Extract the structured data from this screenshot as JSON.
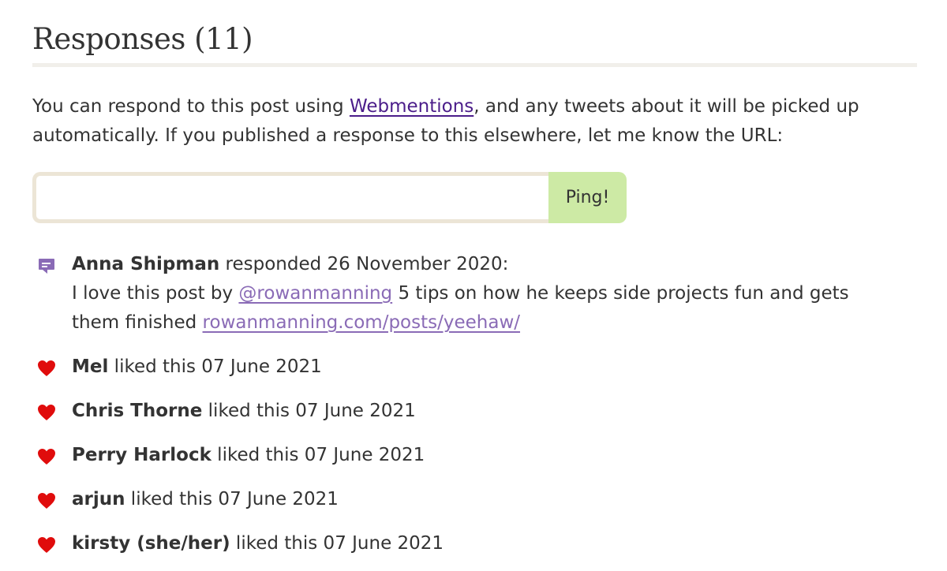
{
  "section": {
    "title": "Responses (11)"
  },
  "intro": {
    "before_link": "You can respond to this post using ",
    "link_text": "Webmentions",
    "after_link": ", and any tweets about it will be picked up automatically. If you published a response to this elsewhere, let me know the URL:"
  },
  "ping_form": {
    "input_value": "",
    "input_placeholder": "",
    "button_label": "Ping!"
  },
  "reply": {
    "icon": "comment-icon",
    "author": "Anna Shipman",
    "action": " responded 26 November 2020:",
    "text_before_mention": "I love this post by ",
    "mention": "@rowanmanning",
    "text_after_mention": " 5 tips on how he keeps side projects fun and gets them finished ",
    "url_text": "rowanmanning.com/posts/yeehaw/"
  },
  "likes": [
    {
      "icon": "heart-icon",
      "author": "Mel",
      "action": " liked this 07 June 2021"
    },
    {
      "icon": "heart-icon",
      "author": "Chris Thorne",
      "action": " liked this 07 June 2021"
    },
    {
      "icon": "heart-icon",
      "author": "Perry Harlock",
      "action": " liked this 07 June 2021"
    },
    {
      "icon": "heart-icon",
      "author": "arjun",
      "action": " liked this 07 June 2021"
    },
    {
      "icon": "heart-icon",
      "author": "kirsty (she/her)",
      "action": " liked this 07 June 2021"
    }
  ],
  "colors": {
    "text": "#333333",
    "link": "#4b1d8a",
    "mention_link": "#8a6bb6",
    "heart": "#e00c0c",
    "comment_icon": "#8a6bb6",
    "button_bg": "#cdeaa5",
    "input_border": "#ece5d6",
    "rule": "#f1efea"
  }
}
